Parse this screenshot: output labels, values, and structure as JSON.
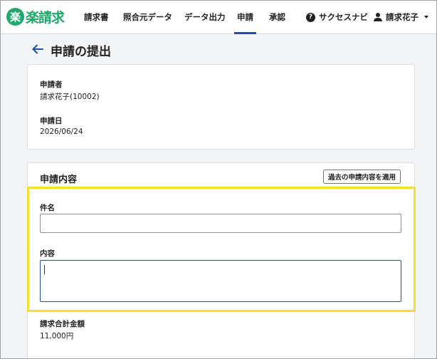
{
  "app": {
    "logo_mark": "楽",
    "logo_text": "楽請求"
  },
  "nav": {
    "items": [
      {
        "label": "請求書",
        "active": false
      },
      {
        "label": "照合元データ",
        "active": false
      },
      {
        "label": "データ出力",
        "active": false
      },
      {
        "label": "申請",
        "active": true
      },
      {
        "label": "承認",
        "active": false
      }
    ],
    "help_label": "サクセスナビ",
    "user_label": "請求花子"
  },
  "page": {
    "title": "申請の提出"
  },
  "applicant_card": {
    "applicant_label": "申請者",
    "applicant_value": "請求花子(10002)",
    "date_label": "申請日",
    "date_value": "2026/06/24"
  },
  "content_card": {
    "section_title": "申請内容",
    "apply_past_button": "過去の申請内容を適用",
    "subject_label": "件名",
    "subject_value": "",
    "body_label": "内容",
    "body_value": "",
    "total_label": "請求合計金額",
    "total_value": "11,000円"
  },
  "colors": {
    "brand": "#1ea86b",
    "accent": "#1f4fa8",
    "highlight": "#f5df2a"
  }
}
